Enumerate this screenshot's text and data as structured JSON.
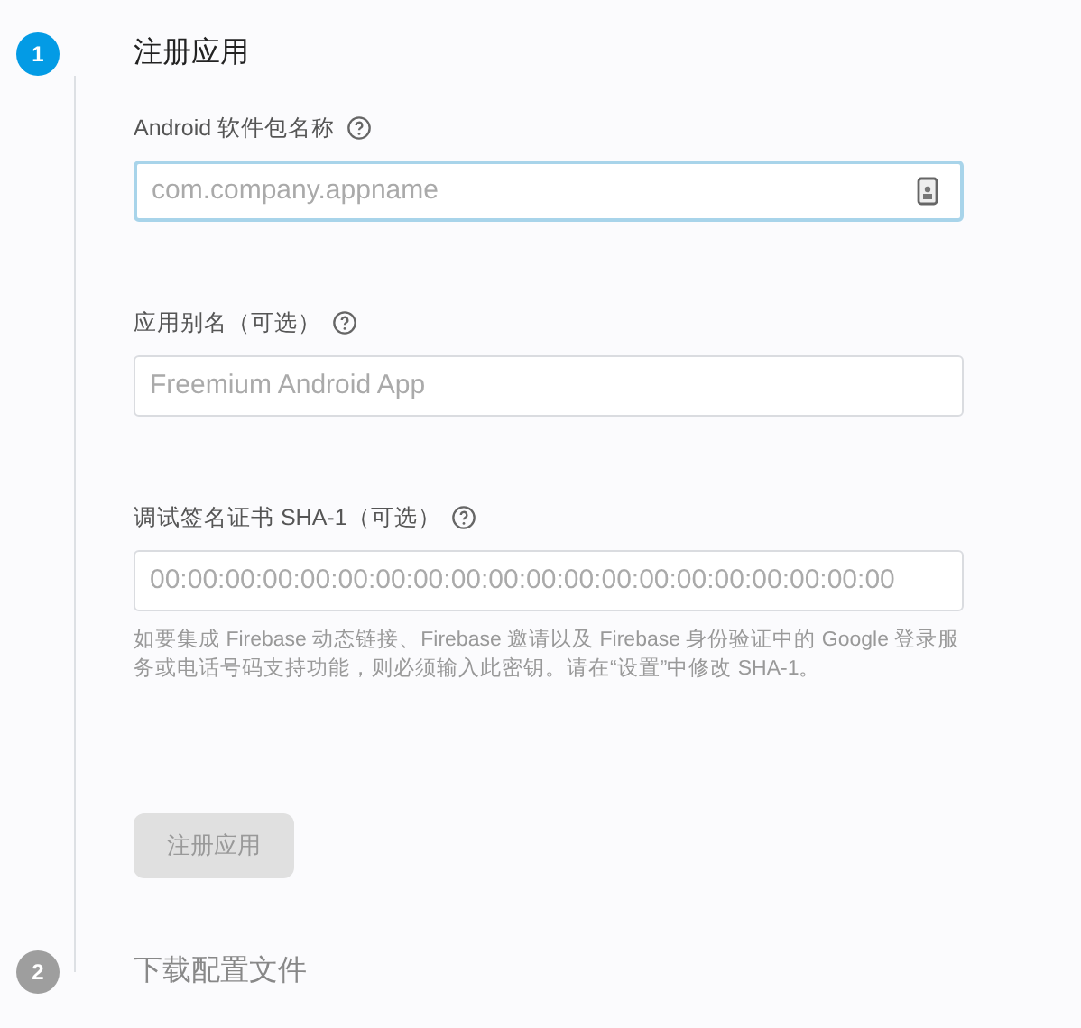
{
  "steps": [
    {
      "number": "1",
      "title": "注册应用",
      "active": true,
      "fields": [
        {
          "label": "Android 软件包名称",
          "placeholder": "com.company.appname",
          "focused": true,
          "has_icon": true
        },
        {
          "label": "应用别名（可选）",
          "placeholder": "Freemium Android App",
          "focused": false,
          "has_icon": false
        },
        {
          "label": "调试签名证书 SHA-1（可选）",
          "placeholder": "00:00:00:00:00:00:00:00:00:00:00:00:00:00:00:00:00:00:00:00",
          "focused": false,
          "has_icon": false,
          "help": "如要集成 Firebase 动态链接、Firebase 邀请以及 Firebase 身份验证中的 Google 登录服务或电话号码支持功能，则必须输入此密钥。请在“设置”中修改 SHA-1。"
        }
      ],
      "button": {
        "label": "注册应用",
        "disabled": true
      }
    },
    {
      "number": "2",
      "title": "下载配置文件",
      "active": false
    }
  ]
}
